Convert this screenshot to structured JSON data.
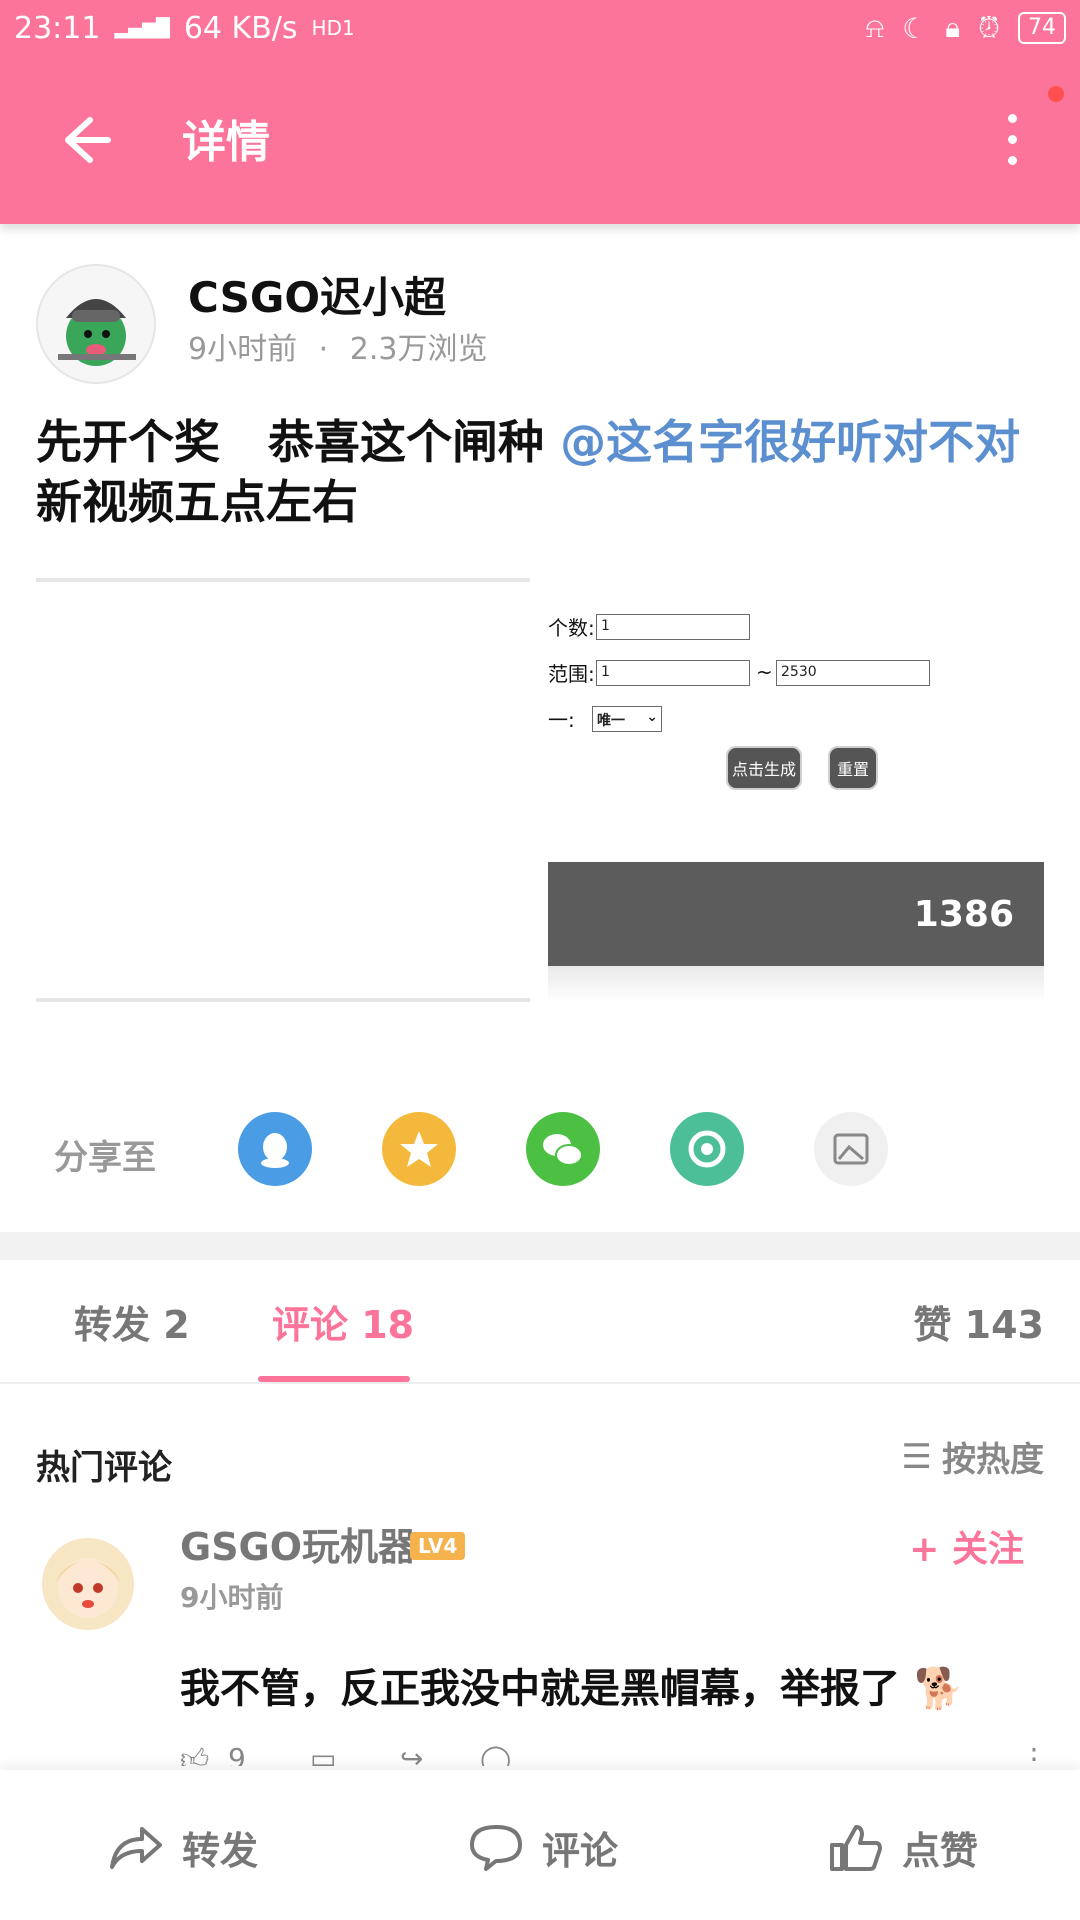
{
  "status_bar": {
    "time": "23:11",
    "network": "4G",
    "speed": "64 KB/s",
    "hd": "HD1",
    "battery": "74"
  },
  "app_bar": {
    "title": "详情"
  },
  "post": {
    "author_name": "CSGO迟小超",
    "time_ago": "9小时前",
    "dot": "·",
    "views": "2.3万浏览",
    "text_part1": "先开个奖   恭喜这个闸种 ",
    "mention": "@这名字很好听对不对",
    "text_line2": "新视频五点左右"
  },
  "post_image": {
    "label_count": "个数:",
    "value_count": "1",
    "label_range": "范围:",
    "value_range_from": "1",
    "range_sep": "~",
    "value_range_to": "2530",
    "label_unique": "一:",
    "select_value": "唯一",
    "generate_btn": "点击生成",
    "reset_btn": "重置",
    "result": "1386"
  },
  "share": {
    "label": "分享至",
    "icons": [
      "qq-icon",
      "qzone-icon",
      "wechat-icon",
      "moments-icon",
      "gallery-icon"
    ],
    "colors": [
      "#4a9de5",
      "#f4b93c",
      "#4cc043",
      "#4cbf98",
      "#f0f0f0"
    ]
  },
  "tabs": {
    "forward": "转发 2",
    "comments": "评论 18",
    "likes": "赞 143"
  },
  "comments_section": {
    "title": "热门评论",
    "sort_label": "按热度"
  },
  "comment": {
    "user": "GSGO玩机器",
    "level": "LV4",
    "follow": "+ 关注",
    "time": "9小时前",
    "text": "我不管，反正我没中就是黑帽幕，举报了",
    "like_count": "9"
  },
  "bottom_bar": {
    "forward": "转发",
    "comment": "评论",
    "like": "点赞"
  },
  "colors": {
    "accent": "#fc7499",
    "mention": "#5b8fcf"
  }
}
